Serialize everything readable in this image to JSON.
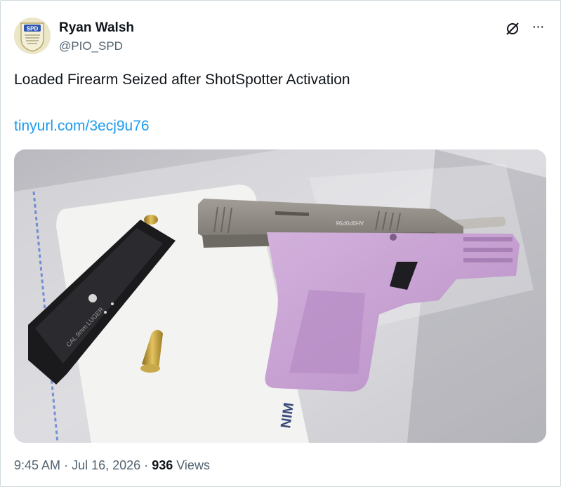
{
  "author": {
    "name": "Ryan Walsh",
    "handle": "@PIO_SPD",
    "avatar_text": "SPD"
  },
  "header_icons": [
    "grok-icon",
    "more-icon"
  ],
  "more_label": "···",
  "tweet": {
    "text": "Loaded Firearm Seized after ShotSpotter Activation",
    "link": "tinyurl.com/3ecj9u76"
  },
  "image": {
    "slide_engraving": "AH0P0P96",
    "magazine_engraving": "CAL 9mm LUGER",
    "envelope_text": "NIM"
  },
  "meta": {
    "time": "9:45 AM",
    "separator": "·",
    "date": "Jul 16, 2026",
    "views_count": "936",
    "views_label": "Views"
  },
  "colors": {
    "link": "#1d9bf0",
    "secondary_text": "#536471",
    "border": "#cfd9de",
    "frame_purple": "#c8a3d3"
  }
}
